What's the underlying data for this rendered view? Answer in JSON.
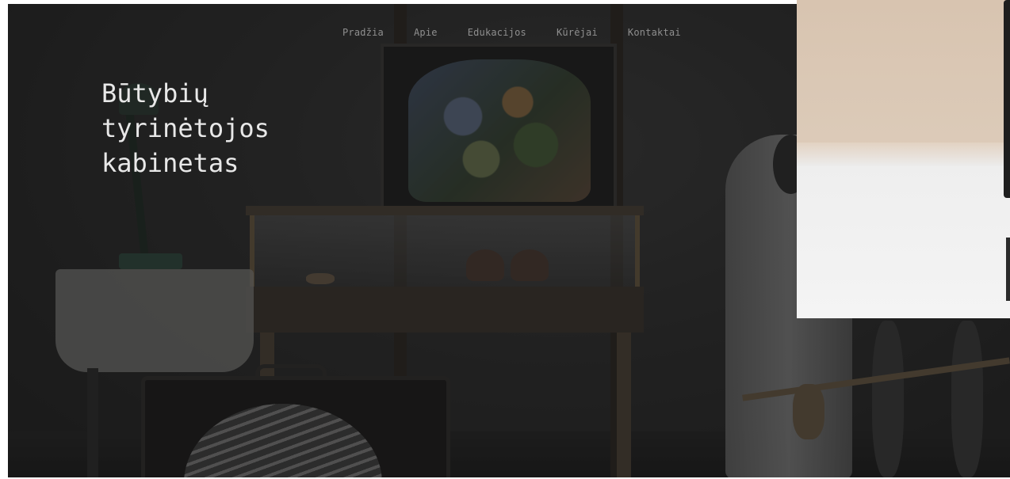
{
  "nav": {
    "items": [
      {
        "label": "Pradžia"
      },
      {
        "label": "Apie"
      },
      {
        "label": "Edukacijos"
      },
      {
        "label": "Kūrėjai"
      },
      {
        "label": "Kontaktai"
      }
    ]
  },
  "hero": {
    "title_lines": [
      "Būtybių",
      "tyrinėtojos",
      "kabinetas"
    ]
  },
  "colors": {
    "background": "#2c2c2c",
    "title_text": "#e8e8e8",
    "nav_text": "#8f8f8f"
  }
}
